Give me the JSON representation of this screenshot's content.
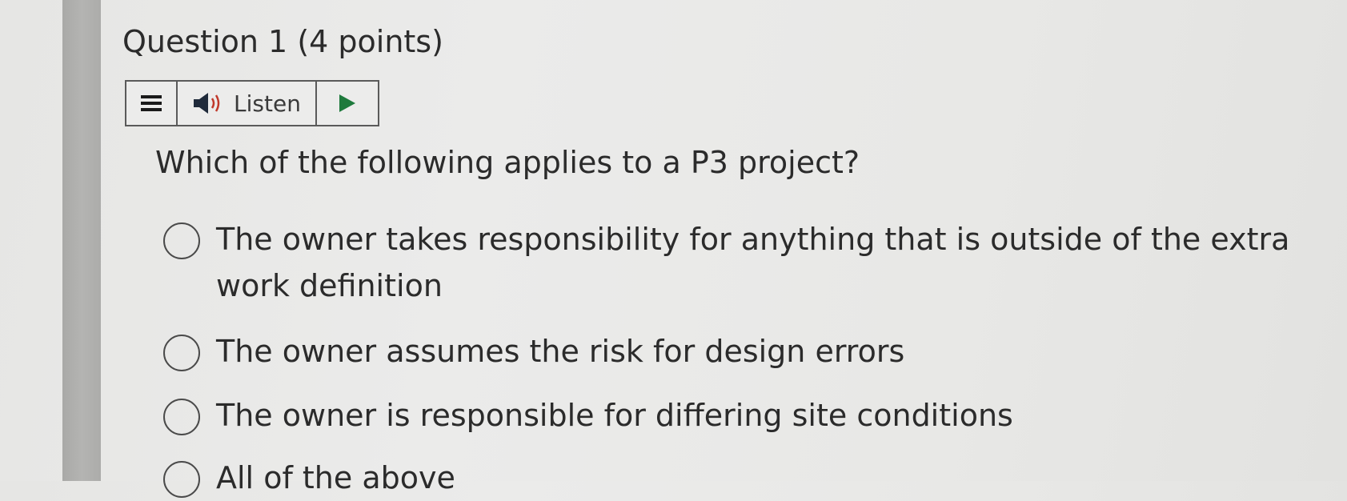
{
  "question": {
    "title": "Question 1",
    "points": "(4 points)",
    "text": "Which of the following applies to a P3 project?"
  },
  "listen_bar": {
    "menu_icon": "hamburger-icon",
    "speaker_icon": "speaker-icon",
    "listen_label": "Listen",
    "play_icon": "play-icon",
    "play_color": "#1e7a3c"
  },
  "options": [
    {
      "label": "The owner takes responsibility for anything that is outside of the extra work definition",
      "selected": false
    },
    {
      "label": "The owner assumes the risk for design errors",
      "selected": false
    },
    {
      "label": "The owner is responsible for differing site conditions",
      "selected": false
    },
    {
      "label": "All of the above",
      "selected": false
    }
  ]
}
